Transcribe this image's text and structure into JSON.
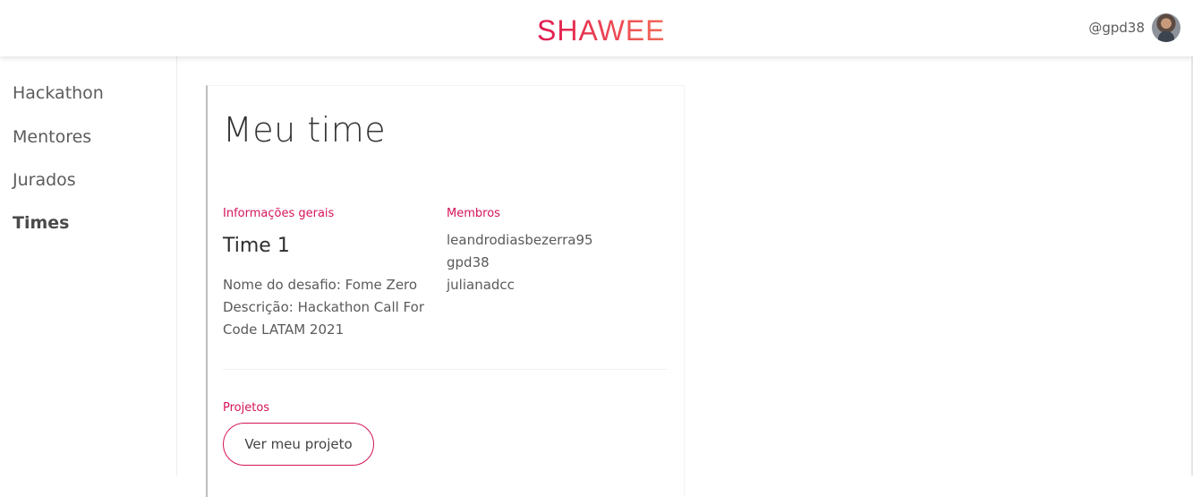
{
  "header": {
    "logo_text": "SHAWEE",
    "username": "@gpd38"
  },
  "sidebar": {
    "items": [
      {
        "label": "Hackathon"
      },
      {
        "label": "Mentores"
      },
      {
        "label": "Jurados"
      },
      {
        "label": "Times",
        "active": true
      }
    ]
  },
  "main": {
    "title": "Meu time",
    "general_info_label": "Informações gerais",
    "team_name": "Time 1",
    "description": "Nome do desafio: Fome Zero Descrição: Hackathon Call For Code LATAM 2021",
    "members_label": "Membros",
    "members": [
      "leandrodiasbezerra95",
      "gpd38",
      "julianadcc"
    ],
    "projects_label": "Projetos",
    "view_project_button": "Ver meu projeto"
  },
  "colors": {
    "accent": "#d4145a",
    "logo_gradient_start": "#e0184f",
    "logo_gradient_end": "#f26a57"
  }
}
